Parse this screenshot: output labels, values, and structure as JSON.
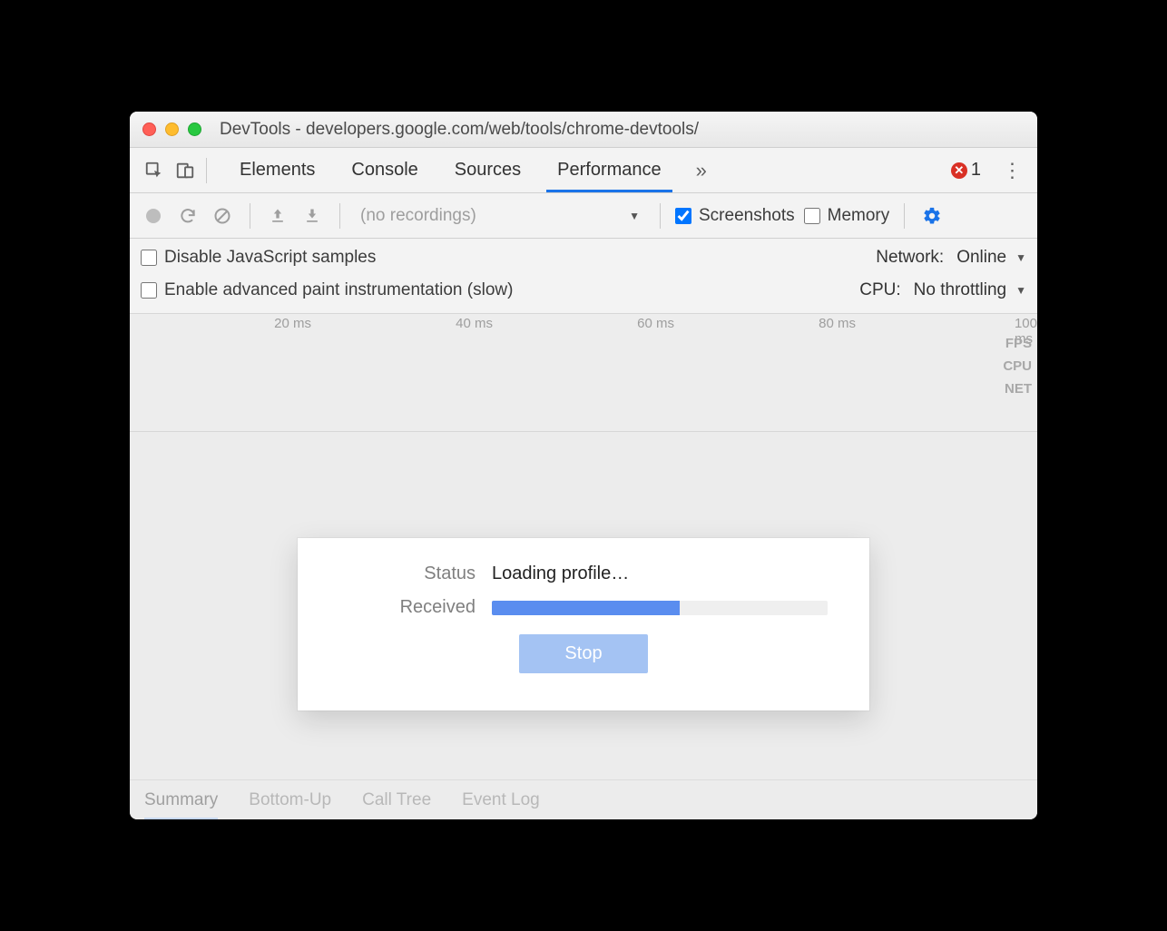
{
  "window": {
    "title": "DevTools - developers.google.com/web/tools/chrome-devtools/"
  },
  "panelTabs": {
    "items": [
      "Elements",
      "Console",
      "Sources",
      "Performance"
    ],
    "activeIndex": 3
  },
  "errors": {
    "count": "1"
  },
  "controls": {
    "recordings_placeholder": "(no recordings)",
    "screenshots_label": "Screenshots",
    "memory_label": "Memory"
  },
  "settings": {
    "disable_js_label": "Disable JavaScript samples",
    "enable_paint_label": "Enable advanced paint instrumentation (slow)",
    "network_label": "Network:",
    "network_value": "Online",
    "cpu_label": "CPU:",
    "cpu_value": "No throttling"
  },
  "timeline": {
    "ticks": [
      "20 ms",
      "40 ms",
      "60 ms",
      "80 ms",
      "100 ms"
    ],
    "tracks": [
      "FPS",
      "CPU",
      "NET"
    ]
  },
  "dialog": {
    "status_label": "Status",
    "status_value": "Loading profile…",
    "received_label": "Received",
    "progress_pct": 56,
    "stop_label": "Stop"
  },
  "bottomTabs": {
    "items": [
      "Summary",
      "Bottom-Up",
      "Call Tree",
      "Event Log"
    ],
    "activeIndex": 0
  }
}
